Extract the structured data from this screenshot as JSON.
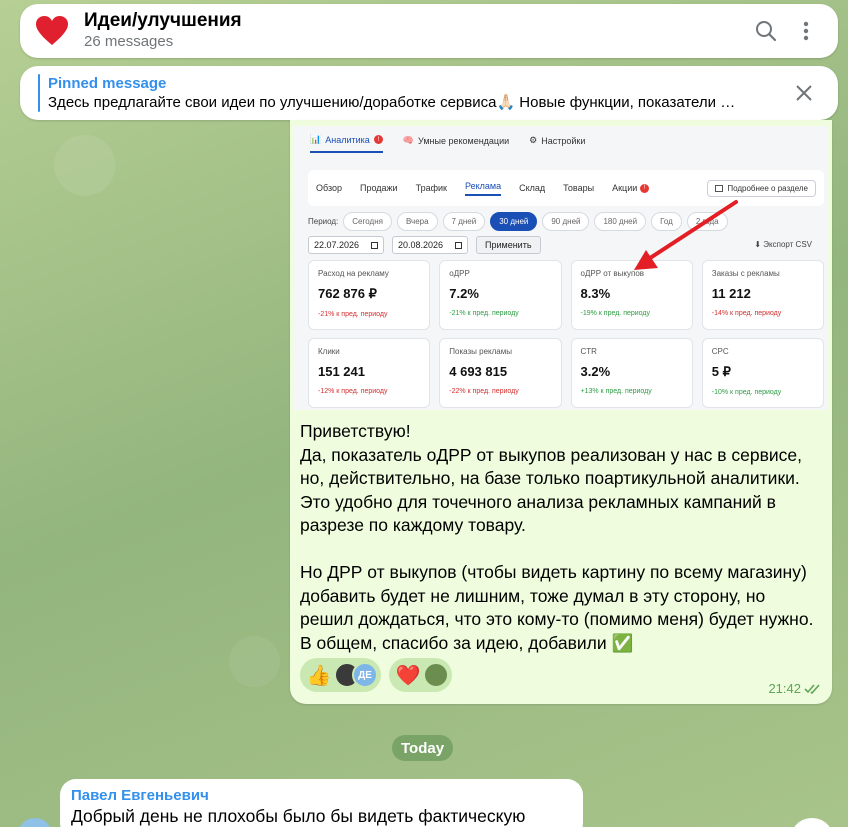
{
  "header": {
    "title": "Идеи/улучшения",
    "subtitle": "26 messages"
  },
  "pinned": {
    "title": "Pinned message",
    "text": "Здесь предлагайте свои идеи по улучшению/доработке сервиса🙏🏻 Новые функции, показатели …"
  },
  "screenshot": {
    "tabs": [
      {
        "label": "Аналитика",
        "badge": "!"
      },
      {
        "label": "Умные рекомендации"
      },
      {
        "label": "Настройки"
      }
    ],
    "subtabs": [
      "Обзор",
      "Продажи",
      "Трафик",
      "Реклама",
      "Склад",
      "Товары",
      "Акции"
    ],
    "subtab_badge": "!",
    "about_label": "Подробнее о разделе",
    "period_label": "Период:",
    "period_chips": [
      "Сегодня",
      "Вчера",
      "7 дней",
      "30 дней",
      "90 дней",
      "180 дней",
      "Год",
      "2 года"
    ],
    "date_from": "22.07.2026",
    "date_to": "20.08.2026",
    "apply_label": "Применить",
    "export_label": "⬇ Экспорт CSV",
    "cards": [
      {
        "label": "Расход на рекламу",
        "value": "762 876 ₽",
        "delta": "-21% к пред. периоду",
        "trend": "neg"
      },
      {
        "label": "оДРР",
        "value": "7.2%",
        "delta": "-21% к пред. периоду",
        "trend": "pos"
      },
      {
        "label": "оДРР от выкупов",
        "value": "8.3%",
        "delta": "-19% к пред. периоду",
        "trend": "pos"
      },
      {
        "label": "Заказы с рекламы",
        "value": "11 212",
        "delta": "-14% к пред. периоду",
        "trend": "neg"
      },
      {
        "label": "Клики",
        "value": "151 241",
        "delta": "-12% к пред. периоду",
        "trend": "neg"
      },
      {
        "label": "Показы рекламы",
        "value": "4 693 815",
        "delta": "-22% к пред. периоду",
        "trend": "neg"
      },
      {
        "label": "CTR",
        "value": "3.2%",
        "delta": "+13% к пред. периоду",
        "trend": "pos"
      },
      {
        "label": "CPC",
        "value": "5 ₽",
        "delta": "-10% к пред. периоду",
        "trend": "pos"
      }
    ]
  },
  "message": {
    "text": "Приветствую!\nДа, показатель оДРР от выкупов реализован у нас в сервисе, но, действительно, на базе только поартикульной аналитики. Это удобно для точечного анализа рекламных кампаний в разрезе по каждому товару.\n\nНо ДРР от выкупов (чтобы видеть картину по всему магазину) добавить будет не лишним, тоже думал в эту сторону, но решил дождаться, что это кому-то (помимо меня) будет нужно. В общем, спасибо за идею, добавили ✅",
    "time": "21:42",
    "reactions": [
      {
        "emoji": "👍",
        "avatars": [
          "avatar-1",
          "ДЕ"
        ]
      },
      {
        "emoji": "❤️",
        "avatars": [
          "avatar-3"
        ]
      }
    ]
  },
  "date_divider": "Today",
  "incoming": {
    "sender": "Павел Евгеньевич",
    "text": "Добрый день не плохобы было бы видеть фактическую"
  },
  "colors": {
    "accent": "#3390ec",
    "bubble_out": "#effdde",
    "time": "#5fa557",
    "arrow": "#e31e24"
  }
}
